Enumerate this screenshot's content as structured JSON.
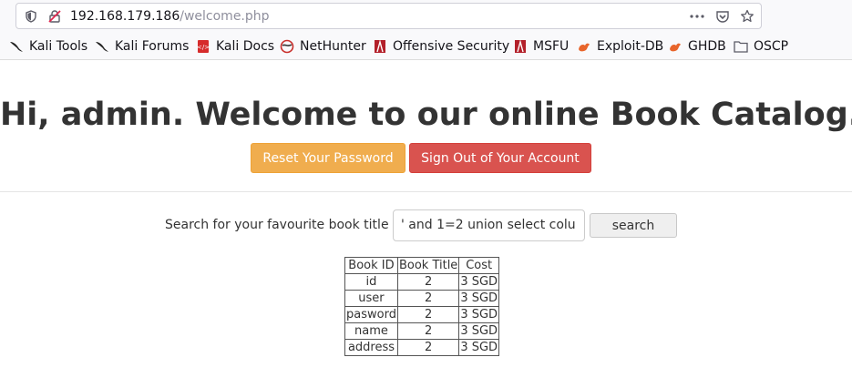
{
  "browser": {
    "url_host": "192.168.179.186",
    "url_path": "/welcome.php",
    "bookmarks": [
      {
        "label": "Kali Tools",
        "icon": "kali-dragon-icon"
      },
      {
        "label": "Kali Forums",
        "icon": "kali-dragon-icon"
      },
      {
        "label": "Kali Docs",
        "icon": "kali-docs-icon"
      },
      {
        "label": "NetHunter",
        "icon": "nethunter-icon"
      },
      {
        "label": "Offensive Security",
        "icon": "offsec-icon"
      },
      {
        "label": "MSFU",
        "icon": "offsec-icon"
      },
      {
        "label": "Exploit-DB",
        "icon": "exploitdb-icon"
      },
      {
        "label": "GHDB",
        "icon": "exploitdb-icon"
      },
      {
        "label": "OSCP",
        "icon": "folder-icon"
      }
    ]
  },
  "page": {
    "greeting_prefix": "Hi, ",
    "username": "admin",
    "greeting_suffix": ". Welcome to our online Book Catalog.",
    "reset_button": "Reset Your Password",
    "signout_button": "Sign Out of Your Account",
    "search_label": "Search for your favourite book title",
    "search_value": "' and 1=2 union select colu",
    "search_button": "search"
  },
  "table": {
    "headers": [
      "Book ID",
      "Book Title",
      "Cost"
    ],
    "rows": [
      [
        "id",
        "2",
        "3 SGD"
      ],
      [
        "user",
        "2",
        "3 SGD"
      ],
      [
        "pasword",
        "2",
        "3 SGD"
      ],
      [
        "name",
        "2",
        "3 SGD"
      ],
      [
        "address",
        "2",
        "3 SGD"
      ]
    ]
  },
  "colors": {
    "warning_button": "#f0ad4e",
    "danger_button": "#d9534f"
  }
}
